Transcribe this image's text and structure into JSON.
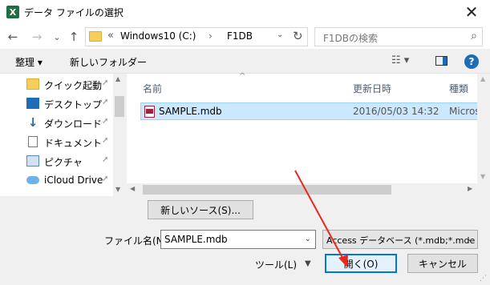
{
  "window": {
    "title": "データ ファイルの選択",
    "close_glyph": "✕",
    "app_icon_letter": "X"
  },
  "address": {
    "back_glyph": "←",
    "forward_glyph": "→",
    "recent_glyph": "⌄",
    "up_glyph": "↑",
    "chevron": "«",
    "segments": [
      "Windows10 (C:)",
      "F1DB"
    ],
    "separator": "›",
    "dropdown_glyph": "⌄",
    "refresh_glyph": "↻"
  },
  "search": {
    "placeholder": "F1DBの検索",
    "icon_glyph": "⌕"
  },
  "toolbar": {
    "organize": "整理 ▾",
    "new_folder": "新しいフォルダー",
    "view_glyph": "☷ ▾",
    "help_glyph": "?"
  },
  "nav": {
    "items": [
      {
        "label": "クイック起動",
        "icon": "folder-icon",
        "color": "#f6cf5a"
      },
      {
        "label": "デスクトップ",
        "icon": "desktop-icon",
        "color": "#1e6bb8"
      },
      {
        "label": "ダウンロード",
        "icon": "download-icon",
        "color": "#1e6bb8"
      },
      {
        "label": "ドキュメント",
        "icon": "document-icon",
        "color": "#777777"
      },
      {
        "label": "ピクチャ",
        "icon": "pictures-icon",
        "color": "#5a8bb5"
      },
      {
        "label": "iCloud Drive",
        "icon": "cloud-icon",
        "color": "#6fb3e6"
      }
    ],
    "pin_glyph": "📌"
  },
  "columns": {
    "name": "名前",
    "date": "更新日時",
    "type": "種類"
  },
  "files": [
    {
      "name": "SAMPLE.mdb",
      "date": "2016/05/03 14:32",
      "type": "Microsof"
    }
  ],
  "buttons": {
    "new_source": "新しいソース(S)...",
    "open": "開く(O)",
    "cancel": "キャンセル"
  },
  "filename": {
    "label": "ファイル名(N):",
    "value": "SAMPLE.mdb"
  },
  "filetype": {
    "value": "Access データベース (*.mdb;*.mde"
  },
  "tools": {
    "label": "ツール(L)",
    "dropdown_glyph": "▼"
  },
  "colors": {
    "accent": "#0078d7",
    "selection": "#cce8ff",
    "annotation_arrow": "#e8291c"
  }
}
